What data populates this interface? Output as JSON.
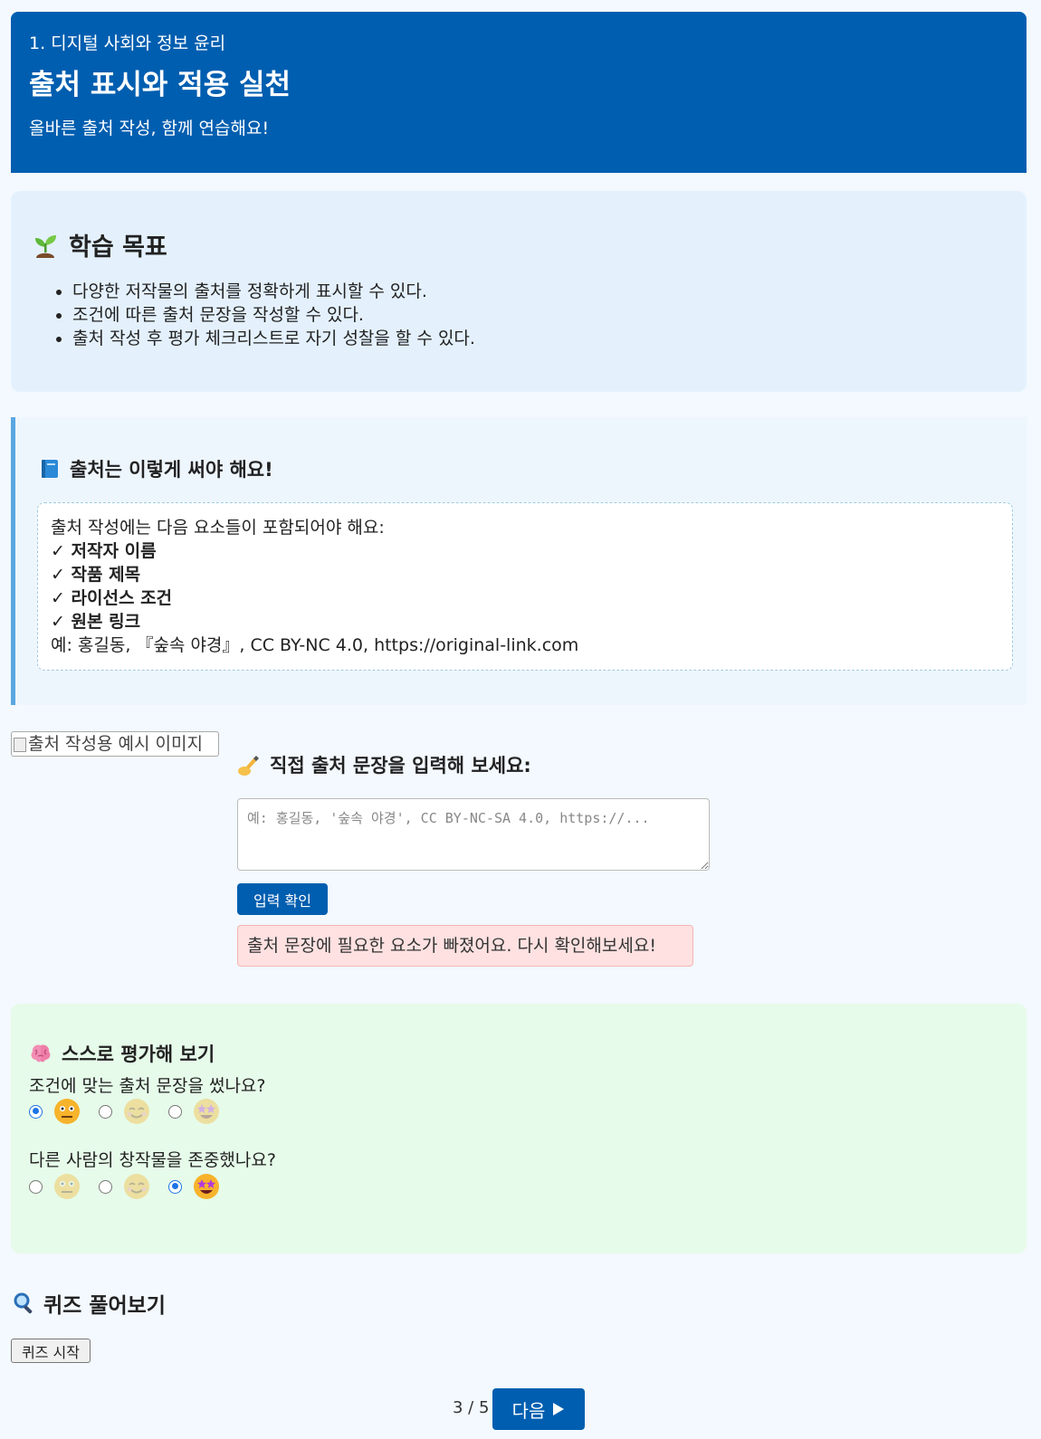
{
  "header": {
    "chapter": "1. 디지털 사회와 정보 윤리",
    "title": "출처 표시와 적용 실천",
    "subtitle": "올바른 출처 작성, 함께 연습해요!",
    "color": "#005eb0"
  },
  "goals": {
    "icon": "seedling-icon",
    "title": "학습 목표",
    "items": [
      "다양한 저작물의 출처를 정확하게 표시할 수 있다.",
      "조건에 따른 출처 문장을 작성할 수 있다.",
      "출처 작성 후 평가 체크리스트로 자기 성찰을 할 수 있다."
    ]
  },
  "guide": {
    "icon": "blue-book-icon",
    "title": "출처는 이렇게 써야 해요!",
    "intro": "출처 작성에는 다음 요소들이 포함되어야 해요:",
    "checklist": [
      "✓ 저작자 이름",
      "✓ 작품 제목",
      "✓ 라이선스 조건",
      "✓ 원본 링크"
    ],
    "example": "예: 홍길동, 『숲속 야경』, CC BY-NC 4.0, https://original-link.com"
  },
  "image": {
    "alt": "출처 작성용 예시 이미지"
  },
  "input_section": {
    "icon": "writing-hand-icon",
    "title": "직접 출처 문장을 입력해 보세요:",
    "placeholder": "예: 홍길동, '숲속 야경', CC BY-NC-SA 4.0, https://...",
    "value": "",
    "confirm_label": "입력 확인",
    "feedback": "출처 문장에 필요한 요소가 빠졌어요. 다시 확인해보세요!"
  },
  "self_assessment": {
    "icon": "brain-icon",
    "title": "스스로 평가해 보기",
    "questions": [
      {
        "text": "조건에 맞는 출처 문장을 썼나요?",
        "options": [
          "neutral-face-icon",
          "smiling-face-icon",
          "star-struck-face-icon"
        ],
        "selected": 0
      },
      {
        "text": "다른 사람의 창작물을 존중했나요?",
        "options": [
          "neutral-face-icon",
          "smiling-face-icon",
          "star-struck-face-icon"
        ],
        "selected": 2
      }
    ]
  },
  "quiz": {
    "icon": "magnifier-icon",
    "title": "퀴즈 풀어보기",
    "start_label": "퀴즈 시작"
  },
  "pager": {
    "count": "3 / 5",
    "next_label": "다음"
  }
}
